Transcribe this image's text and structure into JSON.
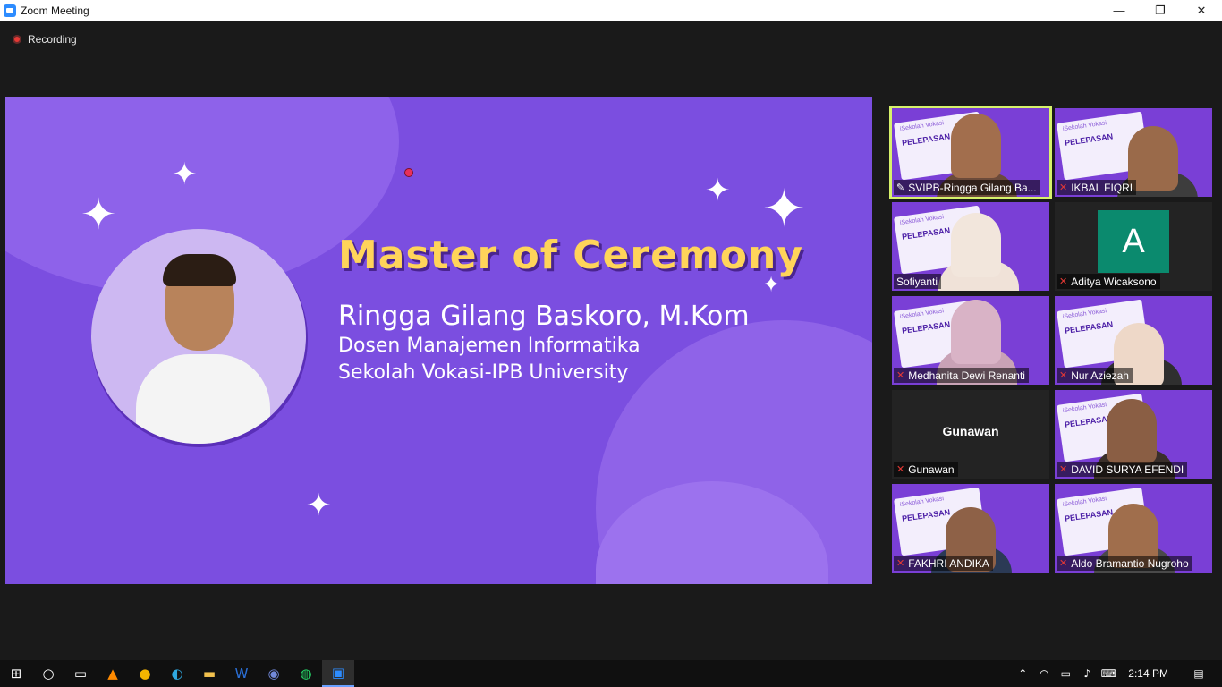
{
  "window": {
    "title": "Zoom Meeting",
    "minimize": "—",
    "restore": "❐",
    "close": "✕"
  },
  "recording": {
    "label": "Recording"
  },
  "slide": {
    "title": "Master of Ceremony",
    "name": "Ringga Gilang Baskoro, M.Kom",
    "line1": "Dosen Manajemen Informatika",
    "line2": "Sekolah Vokasi-IPB University"
  },
  "gallery": {
    "participants": [
      {
        "name": "SVIPB-Ringga Gilang Ba...",
        "muted": false,
        "pinned": true
      },
      {
        "name": "IKBAL FIQRI",
        "muted": true
      },
      {
        "name": "Sofiyanti",
        "muted": false
      },
      {
        "name": "Aditya Wicaksono",
        "muted": true,
        "avatar_letter": "A"
      },
      {
        "name": "Medhanita Dewi Renanti",
        "muted": true
      },
      {
        "name": "Nur Aziezah",
        "muted": true
      },
      {
        "name": "Gunawan",
        "muted": true,
        "display_name": "Gunawan"
      },
      {
        "name": "DAVID SURYA EFENDI",
        "muted": true
      },
      {
        "name": "FAKHRI ANDIKA",
        "muted": true
      },
      {
        "name": "Aldo Bramantio Nugroho",
        "muted": true
      }
    ],
    "card_title": "PELEPASAN",
    "card_sub": "iSekolah Vokasi"
  },
  "taskbar": {
    "clock": "2:14 PM",
    "icons": [
      "windows-start-icon",
      "search-circle-icon",
      "task-view-icon",
      "vlc-icon",
      "chrome-icon",
      "edge-icon",
      "file-explorer-icon",
      "word-icon",
      "discord-icon",
      "whatsapp-icon",
      "zoom-icon"
    ]
  },
  "colors": {
    "slide_bg": "#7b4ee0",
    "title_yellow": "#ffd45a",
    "active_speaker": "#d7f26b",
    "muted_red": "#e53935"
  }
}
